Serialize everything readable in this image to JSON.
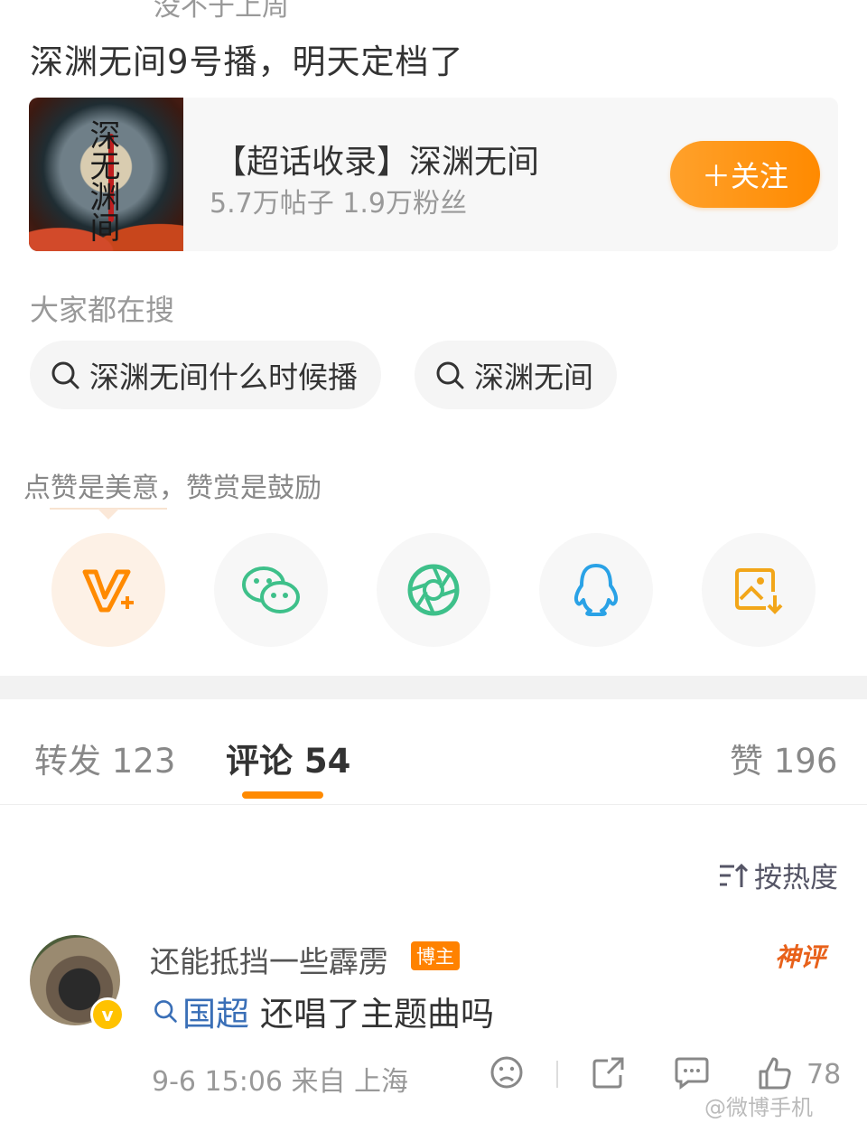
{
  "post": {
    "header_cut": "没不于上周",
    "text": "深渊无间9号播，明天定档了"
  },
  "topic_card": {
    "cover_title": "深无渊间",
    "name": "【超话收录】深渊无间",
    "stats": "5.7万帖子 1.9万粉丝",
    "follow_label": "＋关注"
  },
  "search": {
    "heading": "大家都在搜",
    "chips": [
      "深渊无间什么时候播",
      "深渊无间"
    ]
  },
  "praise_tip": "点赞是美意，赞赏是鼓励",
  "share_icons": [
    "v-plus-reward-icon",
    "wechat-icon",
    "moments-icon",
    "qq-icon",
    "save-image-icon"
  ],
  "tabs": {
    "repost": "转发 123",
    "comments": "评论 54",
    "likes": "赞 196"
  },
  "sort_label": "按热度",
  "comment": {
    "user": "还能抵挡一些霹雳",
    "host_badge": "博主",
    "god_badge": "神评",
    "topic_link": "国超",
    "text": "还唱了主题曲吗",
    "meta": "9-6 15:06  来自 上海",
    "likes": "78",
    "verified_badge": "v"
  },
  "watermark": "@微博手机",
  "colors": {
    "accent": "#ff8a00",
    "link": "#3a6fb7",
    "wechat": "#3ec08a",
    "qq": "#2aa2e6"
  }
}
